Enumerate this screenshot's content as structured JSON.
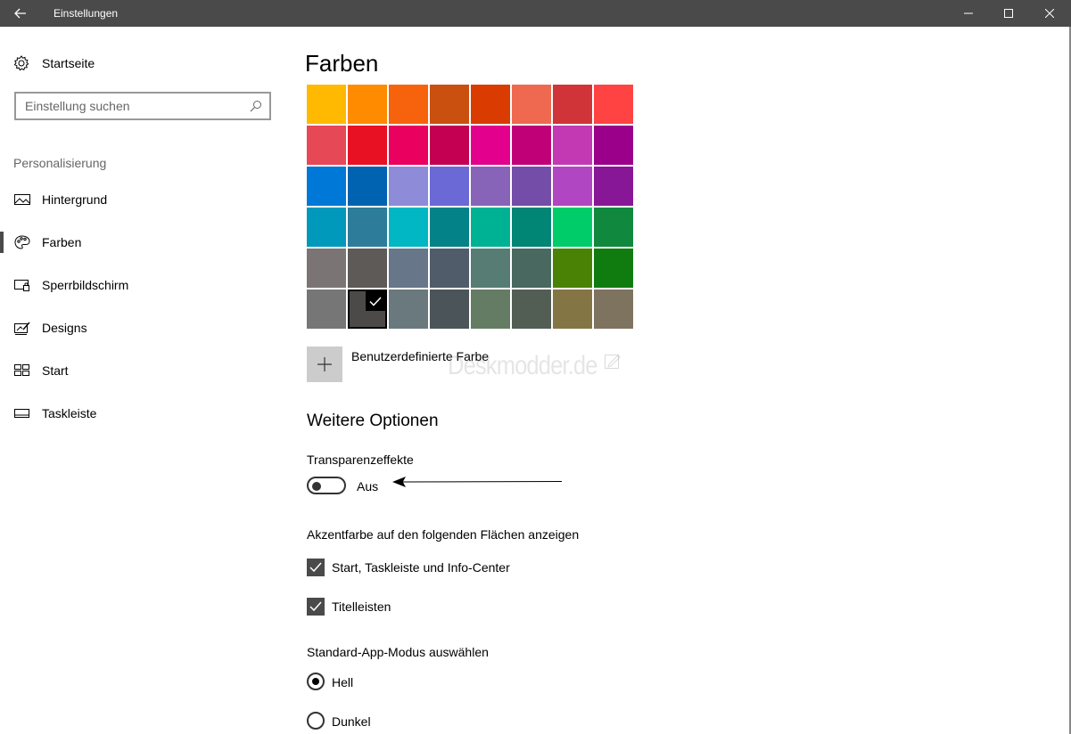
{
  "window": {
    "title": "Einstellungen"
  },
  "sidebar": {
    "home_label": "Startseite",
    "search_placeholder": "Einstellung suchen",
    "section_label": "Personalisierung",
    "items": [
      {
        "label": "Hintergrund",
        "icon": "picture-icon"
      },
      {
        "label": "Farben",
        "icon": "palette-icon",
        "active": true
      },
      {
        "label": "Sperrbildschirm",
        "icon": "lockscreen-icon"
      },
      {
        "label": "Designs",
        "icon": "designs-icon"
      },
      {
        "label": "Start",
        "icon": "start-icon"
      },
      {
        "label": "Taskleiste",
        "icon": "taskbar-icon"
      }
    ]
  },
  "main": {
    "title": "Farben",
    "palette": [
      [
        "#FFB900",
        "#FF8C00",
        "#F7630C",
        "#CA5010",
        "#DA3B01",
        "#EF6950",
        "#D13438",
        "#FF4343"
      ],
      [
        "#E74856",
        "#E81123",
        "#EA005E",
        "#C30052",
        "#E3008C",
        "#BF0077",
        "#C239B3",
        "#9A0089"
      ],
      [
        "#0078D7",
        "#0063B1",
        "#8E8CD8",
        "#6B69D6",
        "#8764B8",
        "#744DA9",
        "#B146C2",
        "#881798"
      ],
      [
        "#0099BC",
        "#2D7D9A",
        "#00B7C3",
        "#038387",
        "#00B294",
        "#018574",
        "#00CC6A",
        "#10893E"
      ],
      [
        "#7A7574",
        "#5D5A58",
        "#68768A",
        "#515C6B",
        "#567C73",
        "#486860",
        "#498205",
        "#107C10"
      ],
      [
        "#767676",
        "#4C4A48",
        "#69797E",
        "#4A5459",
        "#647C64",
        "#525E54",
        "#847545",
        "#7E735F"
      ]
    ],
    "selected_color": "#4C4A48",
    "custom_color_label": "Benutzerdefinierte Farbe",
    "watermark": "Deskmodder.de",
    "more_options_heading": "Weitere Optionen",
    "transparency": {
      "label": "Transparenzeffekte",
      "state": "Aus"
    },
    "accent_surfaces": {
      "label": "Akzentfarbe auf den folgenden Flächen anzeigen",
      "options": [
        {
          "label": "Start, Taskleiste und Info-Center",
          "checked": true
        },
        {
          "label": "Titelleisten",
          "checked": true
        }
      ]
    },
    "app_mode": {
      "label": "Standard-App-Modus auswählen",
      "options": [
        {
          "label": "Hell",
          "selected": true
        },
        {
          "label": "Dunkel",
          "selected": false
        }
      ]
    }
  }
}
